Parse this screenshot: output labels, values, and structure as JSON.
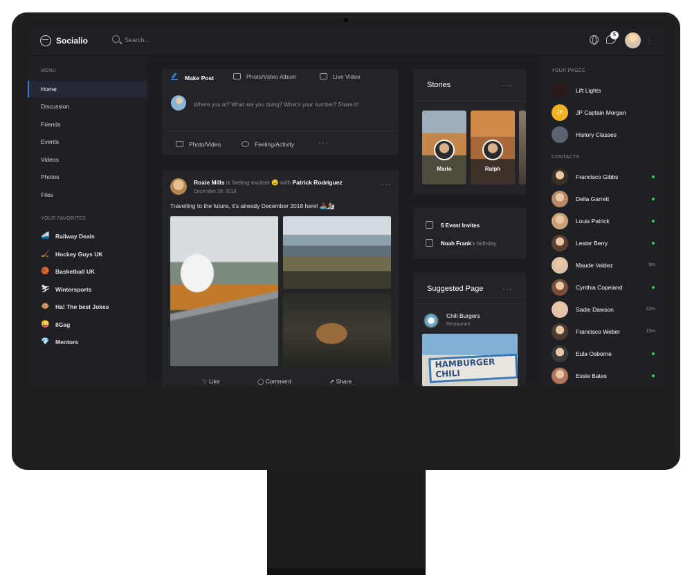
{
  "app": {
    "brand": "Socialio"
  },
  "search": {
    "placeholder": "Search..."
  },
  "header": {
    "notification_count": "5"
  },
  "left_sidebar": {
    "menu_label": "MENU",
    "menu_items": [
      "Home",
      "Discussion",
      "Friends",
      "Events",
      "Videos",
      "Photos",
      "Files"
    ],
    "active_item": "Home",
    "favorites_label": "YOUR FAVORITES",
    "favorites": [
      {
        "emoji": "🚄",
        "label": "Railway Deals"
      },
      {
        "emoji": "🏒",
        "label": "Hockey Guys UK"
      },
      {
        "emoji": "🏀",
        "label": "Basketball UK"
      },
      {
        "emoji": "⛷",
        "label": "Wintersports"
      },
      {
        "emoji": "🐵",
        "label": "Ha! The best Jokes"
      },
      {
        "emoji": "😜",
        "label": "8Gag"
      },
      {
        "emoji": "💎",
        "label": "Mentors"
      }
    ]
  },
  "composer": {
    "tabs": [
      "Make Post",
      "Photo/Video Album",
      "Live Video"
    ],
    "placeholder": "Where you at? What are you doing? What's your number? Share it!",
    "actions": [
      "Photo/Video",
      "Feeling/Activity"
    ]
  },
  "post": {
    "author": "Roxie Mills",
    "feeling": "is feeling excited",
    "feeling_emoji": "😉",
    "with_word": "with",
    "with_person": "Patrick Rodriguez",
    "date": "December 28, 2018",
    "text": "Travelling to the future, it's already December 2018 here! 🚣🏽‍♀️🏂",
    "actions": [
      "Like",
      "Comment",
      "Share"
    ]
  },
  "stories": {
    "title": "Stories",
    "items": [
      "Mario",
      "Ralph"
    ]
  },
  "events": {
    "invites_count": "5 Event Invites",
    "birthday_name": "Noah Frank",
    "birthday_suffix": "'s birthday"
  },
  "suggested": {
    "title": "Suggested Page",
    "name": "Chili Burgers",
    "type": "Restaurant",
    "sign_line1": "HAMBURGER",
    "sign_line2": "CHILI"
  },
  "right_sidebar": {
    "pages_label": "YOUR PAGES",
    "pages": [
      {
        "name": "Lift Lights",
        "initials": "",
        "color": "#2a1a1c"
      },
      {
        "name": "JP Captain Morgan",
        "initials": "JP",
        "color": "#f2b126"
      },
      {
        "name": "History Classes",
        "initials": "",
        "color": "#5b6470"
      }
    ],
    "contacts_label": "CONTACTS",
    "contacts": [
      {
        "name": "Francisco Gibbs",
        "status": "online"
      },
      {
        "name": "Della Garrett",
        "status": "online"
      },
      {
        "name": "Louis Patrick",
        "status": "online"
      },
      {
        "name": "Lester Berry",
        "status": "online"
      },
      {
        "name": "Maude Valdez",
        "status": "9m"
      },
      {
        "name": "Cynthia Copeland",
        "status": "online"
      },
      {
        "name": "Sadie Dawson",
        "status": "32m"
      },
      {
        "name": "Francisco Weber",
        "status": "15m"
      },
      {
        "name": "Eula Osborne",
        "status": "online"
      },
      {
        "name": "Essie Bates",
        "status": "online"
      }
    ]
  },
  "colors": {
    "accent": "#3a7bd5",
    "online": "#47c564",
    "background": "#1c1d21"
  }
}
